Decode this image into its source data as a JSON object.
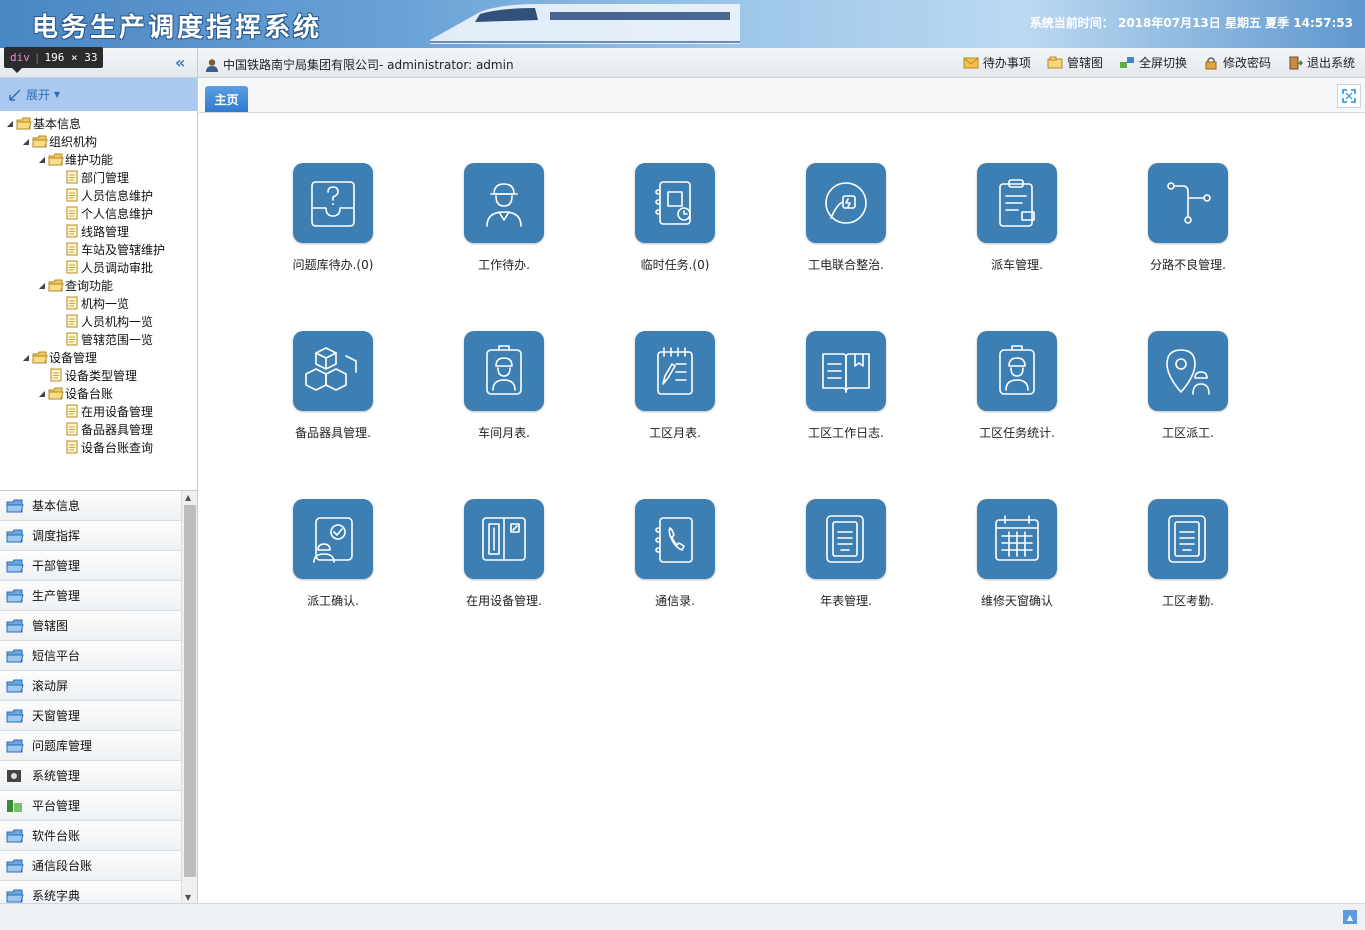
{
  "header": {
    "title": "电务生产调度指挥系统",
    "time_label": "系统当前时间：",
    "time_value": "2018年07月13日 星期五 夏季 14:57:53"
  },
  "devtools_tip": {
    "tag": "div",
    "size": "196 × 33"
  },
  "toolbar": {
    "user": "中国铁路南宁局集团有限公司- administrator: admin",
    "actions": [
      {
        "label": "待办事项",
        "icon": "envelope-icon"
      },
      {
        "label": "管辖图",
        "icon": "map-icon"
      },
      {
        "label": "全屏切换",
        "icon": "switch-icon"
      },
      {
        "label": "修改密码",
        "icon": "lock-icon"
      },
      {
        "label": "退出系统",
        "icon": "exit-icon"
      }
    ]
  },
  "sidebar": {
    "expand_label": "展开",
    "tree": [
      {
        "label": "基本信息",
        "depth": 0,
        "type": "folder",
        "open": true
      },
      {
        "label": "组织机构",
        "depth": 1,
        "type": "folder",
        "open": true
      },
      {
        "label": "维护功能",
        "depth": 2,
        "type": "folder",
        "open": true
      },
      {
        "label": "部门管理",
        "depth": 3,
        "type": "doc"
      },
      {
        "label": "人员信息维护",
        "depth": 3,
        "type": "doc"
      },
      {
        "label": "个人信息维护",
        "depth": 3,
        "type": "doc"
      },
      {
        "label": "线路管理",
        "depth": 3,
        "type": "doc"
      },
      {
        "label": "车站及管辖维护",
        "depth": 3,
        "type": "doc"
      },
      {
        "label": "人员调动审批",
        "depth": 3,
        "type": "doc"
      },
      {
        "label": "查询功能",
        "depth": 2,
        "type": "folder",
        "open": true
      },
      {
        "label": "机构一览",
        "depth": 3,
        "type": "doc"
      },
      {
        "label": "人员机构一览",
        "depth": 3,
        "type": "doc"
      },
      {
        "label": "管辖范围一览",
        "depth": 3,
        "type": "doc"
      },
      {
        "label": "设备管理",
        "depth": 1,
        "type": "folder",
        "open": true
      },
      {
        "label": "设备类型管理",
        "depth": 2,
        "type": "doc"
      },
      {
        "label": "设备台账",
        "depth": 2,
        "type": "folder",
        "open": true
      },
      {
        "label": "在用设备管理",
        "depth": 3,
        "type": "doc"
      },
      {
        "label": "备品器具管理",
        "depth": 3,
        "type": "doc"
      },
      {
        "label": "设备台账查询",
        "depth": 3,
        "type": "doc"
      }
    ],
    "accordion": [
      {
        "label": "基本信息",
        "icon": "folder-icon"
      },
      {
        "label": "调度指挥",
        "icon": "folder-icon"
      },
      {
        "label": "干部管理",
        "icon": "folder-icon"
      },
      {
        "label": "生产管理",
        "icon": "folder-icon"
      },
      {
        "label": "管辖图",
        "icon": "folder-icon"
      },
      {
        "label": "短信平台",
        "icon": "folder-icon"
      },
      {
        "label": "滚动屏",
        "icon": "folder-icon"
      },
      {
        "label": "天窗管理",
        "icon": "folder-icon"
      },
      {
        "label": "问题库管理",
        "icon": "folder-icon"
      },
      {
        "label": "系统管理",
        "icon": "system-icon"
      },
      {
        "label": "平台管理",
        "icon": "platform-icon"
      },
      {
        "label": "软件台账",
        "icon": "folder-icon"
      },
      {
        "label": "通信段台账",
        "icon": "folder-icon"
      },
      {
        "label": "系统字典",
        "icon": "folder-icon"
      }
    ]
  },
  "tabs": {
    "home": "主页"
  },
  "tiles": [
    {
      "label": "问题库待办.(0)",
      "icon": "question-tray-icon"
    },
    {
      "label": "工作待办.",
      "icon": "worker-icon"
    },
    {
      "label": "临时任务.(0)",
      "icon": "notebook-clock-icon"
    },
    {
      "label": "工电联合整治.",
      "icon": "power-plug-icon"
    },
    {
      "label": "派车管理.",
      "icon": "clipboard-icon"
    },
    {
      "label": "分路不良管理.",
      "icon": "route-branch-icon"
    },
    {
      "label": "备品器具管理.",
      "icon": "boxes-icon"
    },
    {
      "label": "车间月表.",
      "icon": "badge-worker-icon"
    },
    {
      "label": "工区月表.",
      "icon": "notepad-pen-icon"
    },
    {
      "label": "工区工作日志.",
      "icon": "open-book-icon"
    },
    {
      "label": "工区任务统计.",
      "icon": "badge-worker-icon"
    },
    {
      "label": "工区派工.",
      "icon": "location-worker-icon"
    },
    {
      "label": "派工确认.",
      "icon": "confirm-worker-icon"
    },
    {
      "label": "在用设备管理.",
      "icon": "cabinet-icon"
    },
    {
      "label": "通信录.",
      "icon": "phone-book-icon"
    },
    {
      "label": "年表管理.",
      "icon": "document-icon"
    },
    {
      "label": "维修天窗确认",
      "icon": "calendar-grid-icon"
    },
    {
      "label": "工区考勤.",
      "icon": "document-icon"
    }
  ]
}
